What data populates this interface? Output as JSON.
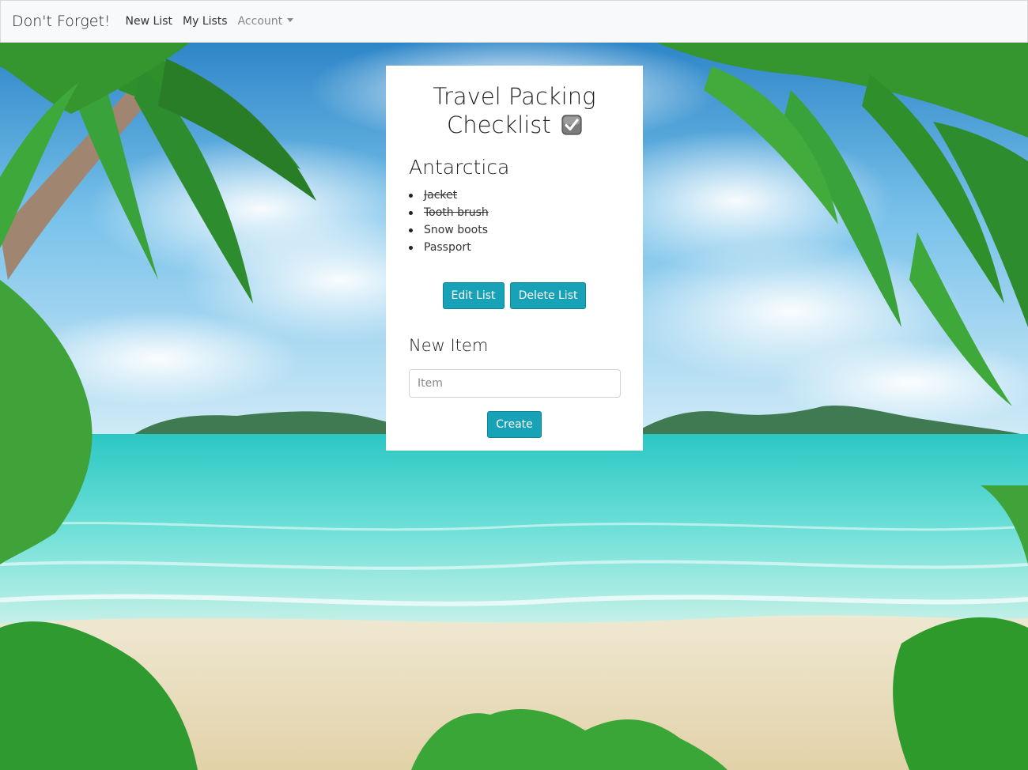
{
  "navbar": {
    "brand": "Don't Forget!",
    "links": [
      "New List",
      "My Lists"
    ],
    "account_label": "Account"
  },
  "card": {
    "title": "Travel Packing Checklist",
    "list_name": "Antarctica",
    "items": [
      {
        "label": "Jacket",
        "checked": true
      },
      {
        "label": "Tooth brush",
        "checked": true
      },
      {
        "label": "Snow boots",
        "checked": false
      },
      {
        "label": "Passport",
        "checked": false
      }
    ],
    "edit_label": "Edit List",
    "delete_label": "Delete List",
    "new_item_title": "New Item",
    "item_placeholder": "Item",
    "create_label": "Create"
  },
  "colors": {
    "accent": "#17a2b8",
    "navbar_bg": "#f8f9fa"
  },
  "icons": {
    "title_icon": "checkbox-checked-icon",
    "account_caret": "caret-down-icon"
  }
}
